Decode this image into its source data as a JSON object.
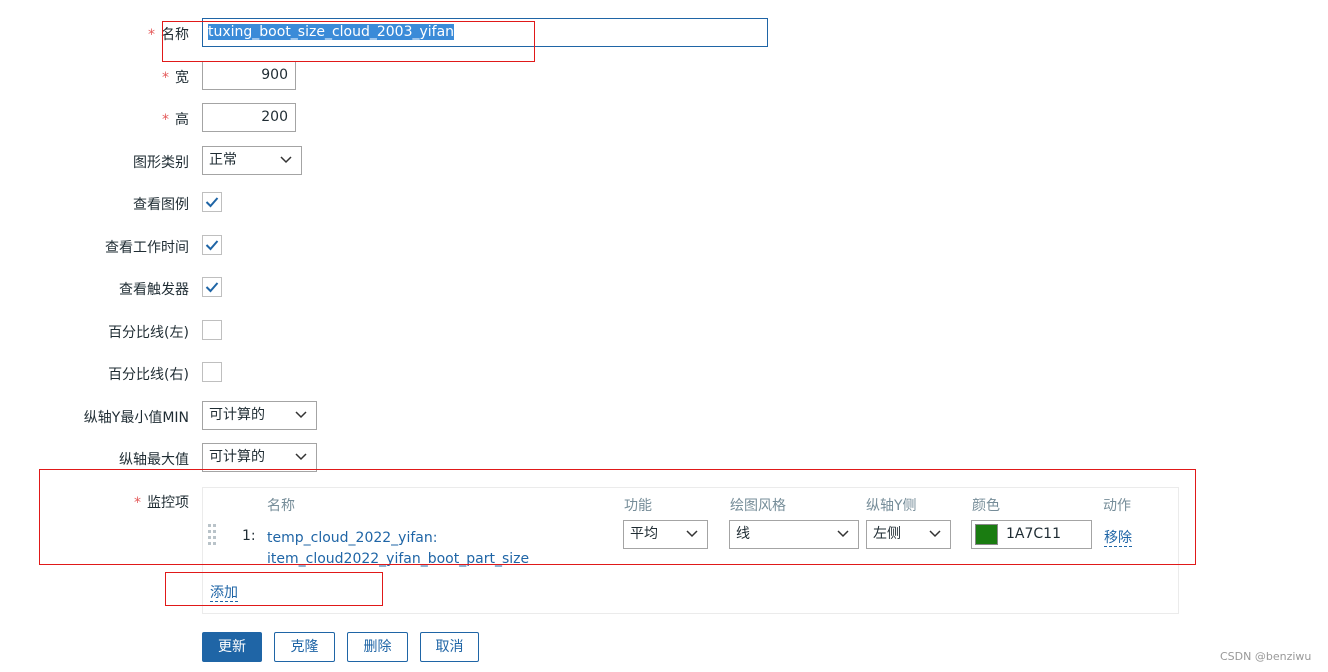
{
  "form": {
    "required_mark": "*",
    "name": {
      "label": "名称",
      "value": "tuxing_boot_size_cloud_2003_yifan"
    },
    "width": {
      "label": "宽",
      "value": "900"
    },
    "height": {
      "label": "高",
      "value": "200"
    },
    "graph_type": {
      "label": "图形类别",
      "value": "正常"
    },
    "show_legend": {
      "label": "查看图例",
      "checked": true
    },
    "show_working_time": {
      "label": "查看工作时间",
      "checked": true
    },
    "show_triggers": {
      "label": "查看触发器",
      "checked": true
    },
    "percentile_left": {
      "label": "百分比线(左)",
      "checked": false
    },
    "percentile_right": {
      "label": "百分比线(右)",
      "checked": false
    },
    "y_min": {
      "label": "纵轴Y最小值MIN",
      "value": "可计算的"
    },
    "y_max": {
      "label": "纵轴最大值",
      "value": "可计算的"
    }
  },
  "items": {
    "label": "监控项",
    "headers": {
      "name": "名称",
      "function": "功能",
      "draw_style": "绘图风格",
      "y_axis_side": "纵轴Y侧",
      "color": "颜色",
      "action": "动作"
    },
    "rows": [
      {
        "index": "1:",
        "name_line1": "temp_cloud_2022_yifan:",
        "name_line2": "item_cloud2022_yifan_boot_part_size",
        "function": "平均",
        "draw_style": "线",
        "y_axis_side": "左侧",
        "color_hex": "1A7C11",
        "swatch": "#1A7C11",
        "action": "移除"
      }
    ],
    "add_link": "添加"
  },
  "buttons": {
    "update": "更新",
    "clone": "克隆",
    "delete": "删除",
    "cancel": "取消"
  },
  "watermark": "CSDN @benziwu",
  "colors": {
    "accent": "#1f65a6",
    "required": "#e45959",
    "highlight": "#e01919",
    "selection": "#3b8bd8"
  }
}
